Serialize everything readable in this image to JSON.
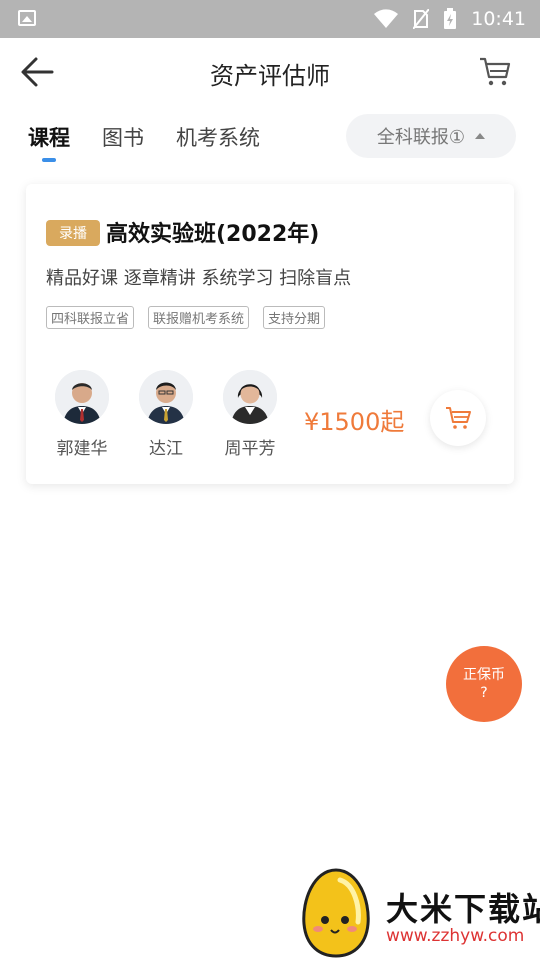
{
  "status_bar": {
    "time": "10:41"
  },
  "header": {
    "title": "资产评估师"
  },
  "tabs": [
    {
      "label": "课程"
    },
    {
      "label": "图书"
    },
    {
      "label": "机考系统"
    }
  ],
  "filter": {
    "label": "全科联报①"
  },
  "course": {
    "badge": "录播",
    "title": "高效实验班(2022年)",
    "subtitle": "精品好课 逐章精讲 系统学习 扫除盲点",
    "tags": [
      "四科联报立省",
      "联报赠机考系统",
      "支持分期"
    ],
    "teachers": [
      {
        "name": "郭建华"
      },
      {
        "name": "达江"
      },
      {
        "name": "周平芳"
      }
    ],
    "price": "¥1500起"
  },
  "coin_button": {
    "line1": "正保币",
    "line2": "?"
  },
  "watermark": {
    "name": "大米下载站",
    "url": "www.zzhyw.com"
  },
  "colors": {
    "accent": "#ef7a3a",
    "tab_indicator": "#3b8fe8",
    "badge": "#d9a95e",
    "coin": "#f26f3c"
  }
}
